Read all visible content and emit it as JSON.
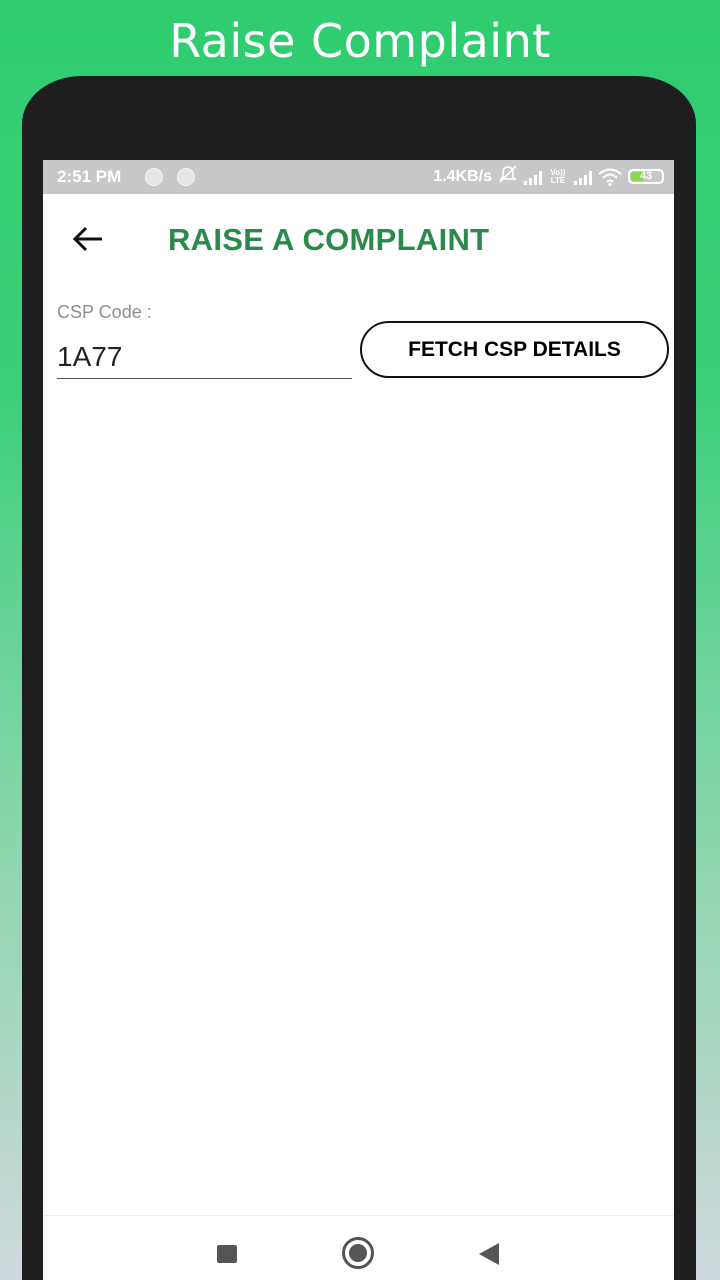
{
  "promo": {
    "title": "Raise Complaint"
  },
  "status_bar": {
    "time": "2:51 PM",
    "network_speed": "1.4KB/s",
    "volte_top": "Vo))",
    "volte_bottom": "LTE",
    "battery_level": "43",
    "icons": [
      "notification-dot-icon",
      "notification-dot-icon",
      "muted-bell-icon",
      "signal-icon",
      "volte-icon",
      "signal-icon",
      "wifi-icon",
      "battery-icon"
    ]
  },
  "app_bar": {
    "title": "RAISE A COMPLAINT",
    "back_icon": "arrow-left-icon"
  },
  "form": {
    "csp_label": "CSP Code :",
    "csp_value": "1A77",
    "fetch_label": "FETCH CSP DETAILS"
  },
  "nav_bar": {
    "icons": [
      "recents-square-icon",
      "home-circle-icon",
      "back-triangle-icon"
    ]
  },
  "colors": {
    "accent": "#2a8a4c",
    "promo_bg_top": "#2fcc6f",
    "status_bar_bg": "#c8c8c8",
    "battery_fill": "#8bd94b"
  }
}
